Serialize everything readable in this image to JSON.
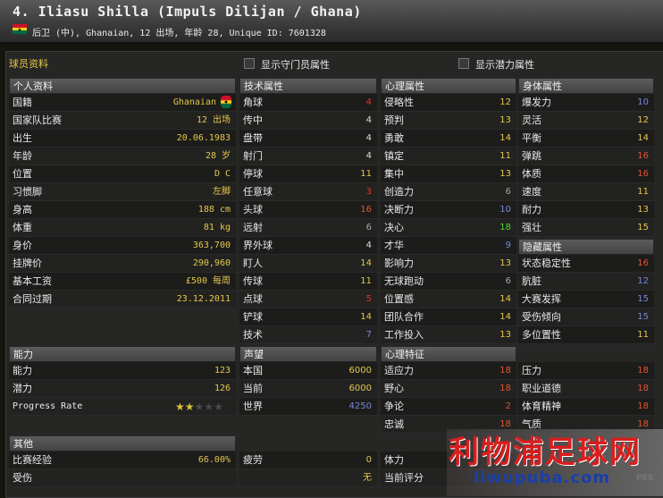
{
  "header": {
    "title": "4. Iliasu Shilla (Impuls Dilijan / Ghana)",
    "subtitle": "后卫 (中), Ghanaian, 12 出场, 年龄 28, Unique ID: 7601328",
    "flag_icon": "ghana-flag-icon"
  },
  "top_bar": {
    "section_title": "球员资料",
    "gk_checkbox_label": "显示守门员属性",
    "potential_checkbox_label": "显示潜力属性"
  },
  "personal": {
    "header": "个人资料",
    "rows": [
      {
        "label": "国籍",
        "value": "Ghanaian"
      },
      {
        "label": "国家队比赛",
        "value": "12 出场"
      },
      {
        "label": "出生",
        "value": "20.06.1983"
      },
      {
        "label": "年龄",
        "value": "28 岁"
      },
      {
        "label": "位置",
        "value": "D C"
      },
      {
        "label": "习惯脚",
        "value": "左脚"
      },
      {
        "label": "身高",
        "value": "188 cm"
      },
      {
        "label": "体重",
        "value": "81 kg"
      },
      {
        "label": "身价",
        "value": "363,700"
      },
      {
        "label": "挂牌价",
        "value": "290,960"
      },
      {
        "label": "基本工资",
        "value": "£500 每周"
      },
      {
        "label": "合同过期",
        "value": "23.12.2011"
      }
    ]
  },
  "ability": {
    "header": "能力",
    "rows": [
      {
        "label": "能力",
        "value": "123"
      },
      {
        "label": "潜力",
        "value": "126"
      }
    ],
    "progress_label": "Progress Rate",
    "progress_stars": 2,
    "progress_max": 5
  },
  "other": {
    "header": "其他",
    "rows": [
      {
        "label": "比赛经验",
        "value": "66.00%"
      },
      {
        "label": "受伤",
        "value": ""
      }
    ]
  },
  "technical": {
    "header": "技术属性",
    "rows": [
      {
        "label": "角球",
        "value": "4",
        "color": "#e2342a"
      },
      {
        "label": "传中",
        "value": "4",
        "color": "#dddddd"
      },
      {
        "label": "盘带",
        "value": "4",
        "color": "#dddddd"
      },
      {
        "label": "射门",
        "value": "4",
        "color": "#dddddd"
      },
      {
        "label": "停球",
        "value": "11",
        "color": "#e4c84a"
      },
      {
        "label": "任意球",
        "value": "3",
        "color": "#e2342a"
      },
      {
        "label": "头球",
        "value": "16",
        "color": "#e2542e"
      },
      {
        "label": "远射",
        "value": "6",
        "color": "#a4a4a4"
      },
      {
        "label": "界外球",
        "value": "4",
        "color": "#dddddd"
      },
      {
        "label": "盯人",
        "value": "14",
        "color": "#e4c84a"
      },
      {
        "label": "传球",
        "value": "11",
        "color": "#e4c84a"
      },
      {
        "label": "点球",
        "value": "5",
        "color": "#e2342a"
      },
      {
        "label": "铲球",
        "value": "14",
        "color": "#e4c84a"
      },
      {
        "label": "技术",
        "value": "7",
        "color": "#7b86d8"
      }
    ]
  },
  "reputation": {
    "header": "声望",
    "rows": [
      {
        "label": "本国",
        "value": "6000",
        "color": "#e4c84a"
      },
      {
        "label": "当前",
        "value": "6000",
        "color": "#e4c84a"
      },
      {
        "label": "世界",
        "value": "4250",
        "color": "#7b86d8"
      }
    ]
  },
  "other_mid": {
    "rows": [
      {
        "label": "疲劳",
        "value": "0",
        "color": "#e4c84a"
      },
      {
        "label": "",
        "value": "无",
        "color": "#e4c84a"
      }
    ]
  },
  "mental": {
    "header": "心理属性",
    "rows": [
      {
        "label": "侵略性",
        "value": "12",
        "color": "#e4c84a"
      },
      {
        "label": "预判",
        "value": "13",
        "color": "#e4c84a"
      },
      {
        "label": "勇敢",
        "value": "14",
        "color": "#e4c84a"
      },
      {
        "label": "镇定",
        "value": "11",
        "color": "#e4c84a"
      },
      {
        "label": "集中",
        "value": "13",
        "color": "#e4c84a"
      },
      {
        "label": "创造力",
        "value": "6",
        "color": "#a4a4a4"
      },
      {
        "label": "决断力",
        "value": "10",
        "color": "#7b86d8"
      },
      {
        "label": "决心",
        "value": "18",
        "color": "#5ad42e"
      },
      {
        "label": "才华",
        "value": "9",
        "color": "#7b86d8"
      },
      {
        "label": "影响力",
        "value": "13",
        "color": "#e4c84a"
      },
      {
        "label": "无球跑动",
        "value": "6",
        "color": "#a4a4a4"
      },
      {
        "label": "位置感",
        "value": "14",
        "color": "#e4c84a"
      },
      {
        "label": "团队合作",
        "value": "14",
        "color": "#e4c84a"
      },
      {
        "label": "工作投入",
        "value": "13",
        "color": "#e4c84a"
      }
    ]
  },
  "mental_traits": {
    "header": "心理特征",
    "rows": [
      {
        "label": "适应力",
        "value": "18",
        "color": "#e2542e"
      },
      {
        "label": "野心",
        "value": "18",
        "color": "#e2542e"
      },
      {
        "label": "争论",
        "value": "2",
        "color": "#e2542e"
      },
      {
        "label": "忠诚",
        "value": "18",
        "color": "#e2542e"
      }
    ]
  },
  "other_right": {
    "rows": [
      {
        "label": "体力",
        "value": ""
      },
      {
        "label": "当前评分",
        "value": ""
      }
    ]
  },
  "physical": {
    "header": "身体属性",
    "rows": [
      {
        "label": "爆发力",
        "value": "10",
        "color": "#7b86d8"
      },
      {
        "label": "灵活",
        "value": "12",
        "color": "#e4c84a"
      },
      {
        "label": "平衡",
        "value": "14",
        "color": "#e4c84a"
      },
      {
        "label": "弹跳",
        "value": "16",
        "color": "#e2542e"
      },
      {
        "label": "体质",
        "value": "16",
        "color": "#e2542e"
      },
      {
        "label": "速度",
        "value": "11",
        "color": "#e4c84a"
      },
      {
        "label": "耐力",
        "value": "13",
        "color": "#e4c84a"
      },
      {
        "label": "强壮",
        "value": "15",
        "color": "#e4c84a"
      }
    ]
  },
  "hidden": {
    "header": "隐藏属性",
    "rows": [
      {
        "label": "状态稳定性",
        "value": "16",
        "color": "#e2542e"
      },
      {
        "label": "肮脏",
        "value": "12",
        "color": "#7b86d8"
      },
      {
        "label": "大赛发挥",
        "value": "15",
        "color": "#7b86d8"
      },
      {
        "label": "受伤倾向",
        "value": "15",
        "color": "#7b86d8"
      },
      {
        "label": "多位置性",
        "value": "11",
        "color": "#e4c84a"
      }
    ]
  },
  "personality": {
    "rows": [
      {
        "label": "压力",
        "value": "18",
        "color": "#e2542e"
      },
      {
        "label": "职业道德",
        "value": "18",
        "color": "#e2542e"
      },
      {
        "label": "体育精神",
        "value": "18",
        "color": "#e2542e"
      },
      {
        "label": "气质",
        "value": "18",
        "color": "#e2542e"
      }
    ]
  },
  "watermark": {
    "text": "利物浦足球网",
    "url": "liwupuba.com",
    "logo_text": "PES"
  }
}
